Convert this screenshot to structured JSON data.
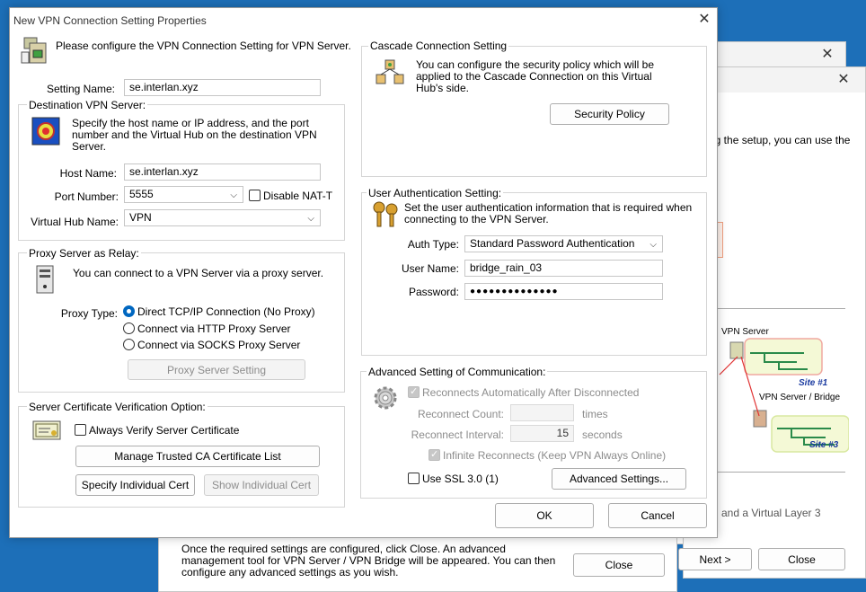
{
  "background": {
    "window_b": {
      "close_icon": "close-icon"
    },
    "window_c": {
      "close_icon": "close-icon",
      "setup_text": "ng the setup, you can use the",
      "diagram_vpn_server": "VPN Server",
      "diagram_site1": "Site #1",
      "diagram_vpn_bridge": "VPN Server / Bridge",
      "diagram_site3": "Site #3",
      "partial_text": "n and a Virtual Layer 3",
      "next_label": "Next >",
      "close_label": "Close"
    },
    "window_bottom": {
      "text": "Once the required settings are configured, click Close. An advanced management tool for VPN Server / VPN Bridge will be appeared. You can then configure any advanced settings as you wish.",
      "close_label": "Close"
    }
  },
  "dialog": {
    "title": "New VPN Connection Setting Properties",
    "intro": "Please configure the VPN Connection Setting for VPN Server.",
    "setting_name_label": "Setting Name:",
    "setting_name_value": "se.interlan.xyz",
    "destination": {
      "group_label": "Destination VPN Server:",
      "description": "Specify the host name or IP address, and the port number and the Virtual Hub on the destination VPN Server.",
      "host_label": "Host Name:",
      "host_value": "se.interlan.xyz",
      "port_label": "Port Number:",
      "port_value": "5555",
      "disable_nat_label": "Disable NAT-T",
      "hub_label": "Virtual Hub Name:",
      "hub_value": "VPN"
    },
    "proxy": {
      "group_label": "Proxy Server as Relay:",
      "description": "You can connect to a VPN Server via a proxy server.",
      "type_label": "Proxy Type:",
      "options": [
        "Direct TCP/IP Connection (No Proxy)",
        "Connect via HTTP Proxy Server",
        "Connect via SOCKS Proxy Server"
      ],
      "setting_button": "Proxy Server Setting"
    },
    "certificate": {
      "group_label": "Server Certificate Verification Option:",
      "always_verify_label": "Always Verify Server Certificate",
      "manage_button": "Manage Trusted CA Certificate List",
      "specify_button": "Specify Individual Cert",
      "show_button": "Show Individual Cert"
    },
    "cascade": {
      "group_label": "Cascade Connection Setting",
      "description": "You can configure the security policy which will be applied to the Cascade Connection on this Virtual Hub's side.",
      "policy_button": "Security Policy"
    },
    "auth": {
      "group_label": "User Authentication Setting:",
      "description": "Set the user authentication information that is required when connecting to the VPN Server.",
      "type_label": "Auth Type:",
      "type_value": "Standard Password Authentication",
      "user_label": "User Name:",
      "user_value": "bridge_rain_03",
      "password_label": "Password:",
      "password_value": "●●●●●●●●●●●●●●"
    },
    "advanced": {
      "group_label": "Advanced Setting of Communication:",
      "reconnect_label": "Reconnects Automatically After Disconnected",
      "count_label": "Reconnect Count:",
      "count_value": "",
      "count_unit": "times",
      "interval_label": "Reconnect Interval:",
      "interval_value": "15",
      "interval_unit": "seconds",
      "infinite_label": "Infinite Reconnects (Keep VPN Always Online)",
      "ssl_label": "Use SSL 3.0 (1)",
      "advanced_button": "Advanced Settings..."
    },
    "ok_label": "OK",
    "cancel_label": "Cancel"
  }
}
